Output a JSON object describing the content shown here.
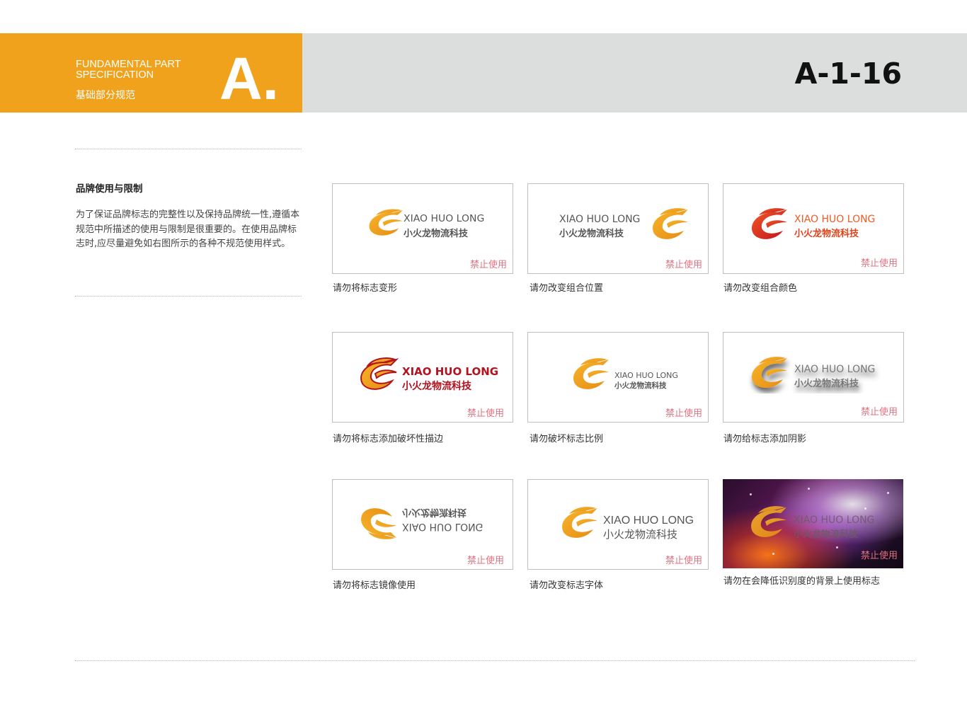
{
  "header": {
    "en_label": "FUNDAMENTAL PART\nSPECIFICATION",
    "zh_label": "基础部分规范",
    "section_letter": "A.",
    "page_number": "A-1-16",
    "colors": {
      "accent": "#f0a21c",
      "band": "#dcdddd",
      "warning": "#e3707f"
    }
  },
  "section": {
    "title": "品牌使用与限制",
    "description": "为了保证品牌标志的完整性以及保持品牌统一性,遵循本规范中所描述的使用与限制是很重要的。在使用品牌标志时,应尽量避免如右图所示的各种不规范使用样式。"
  },
  "logo": {
    "en": "XIAO HUO LONG",
    "zh": "小火龙物流科技",
    "icon": "dragon-swirl-logo-icon"
  },
  "cards": [
    {
      "caption": "请勿将标志变形",
      "badge": "禁止使用"
    },
    {
      "caption": "请勿改变组合位置",
      "badge": "禁止使用"
    },
    {
      "caption": "请勿改变组合颜色",
      "badge": "禁止使用"
    },
    {
      "caption": "请勿将标志添加破坏性描边",
      "badge": "禁止使用"
    },
    {
      "caption": "请勿破坏标志比例",
      "badge": "禁止使用"
    },
    {
      "caption": "请勿给标志添加阴影",
      "badge": "禁止使用"
    },
    {
      "caption": "请勿将标志镜像使用",
      "badge": "禁止使用"
    },
    {
      "caption": "请勿改变标志字体",
      "badge": "禁止使用"
    },
    {
      "caption": "请勿在会降低识别度的背景上使用标志",
      "badge": "禁止使用"
    }
  ]
}
